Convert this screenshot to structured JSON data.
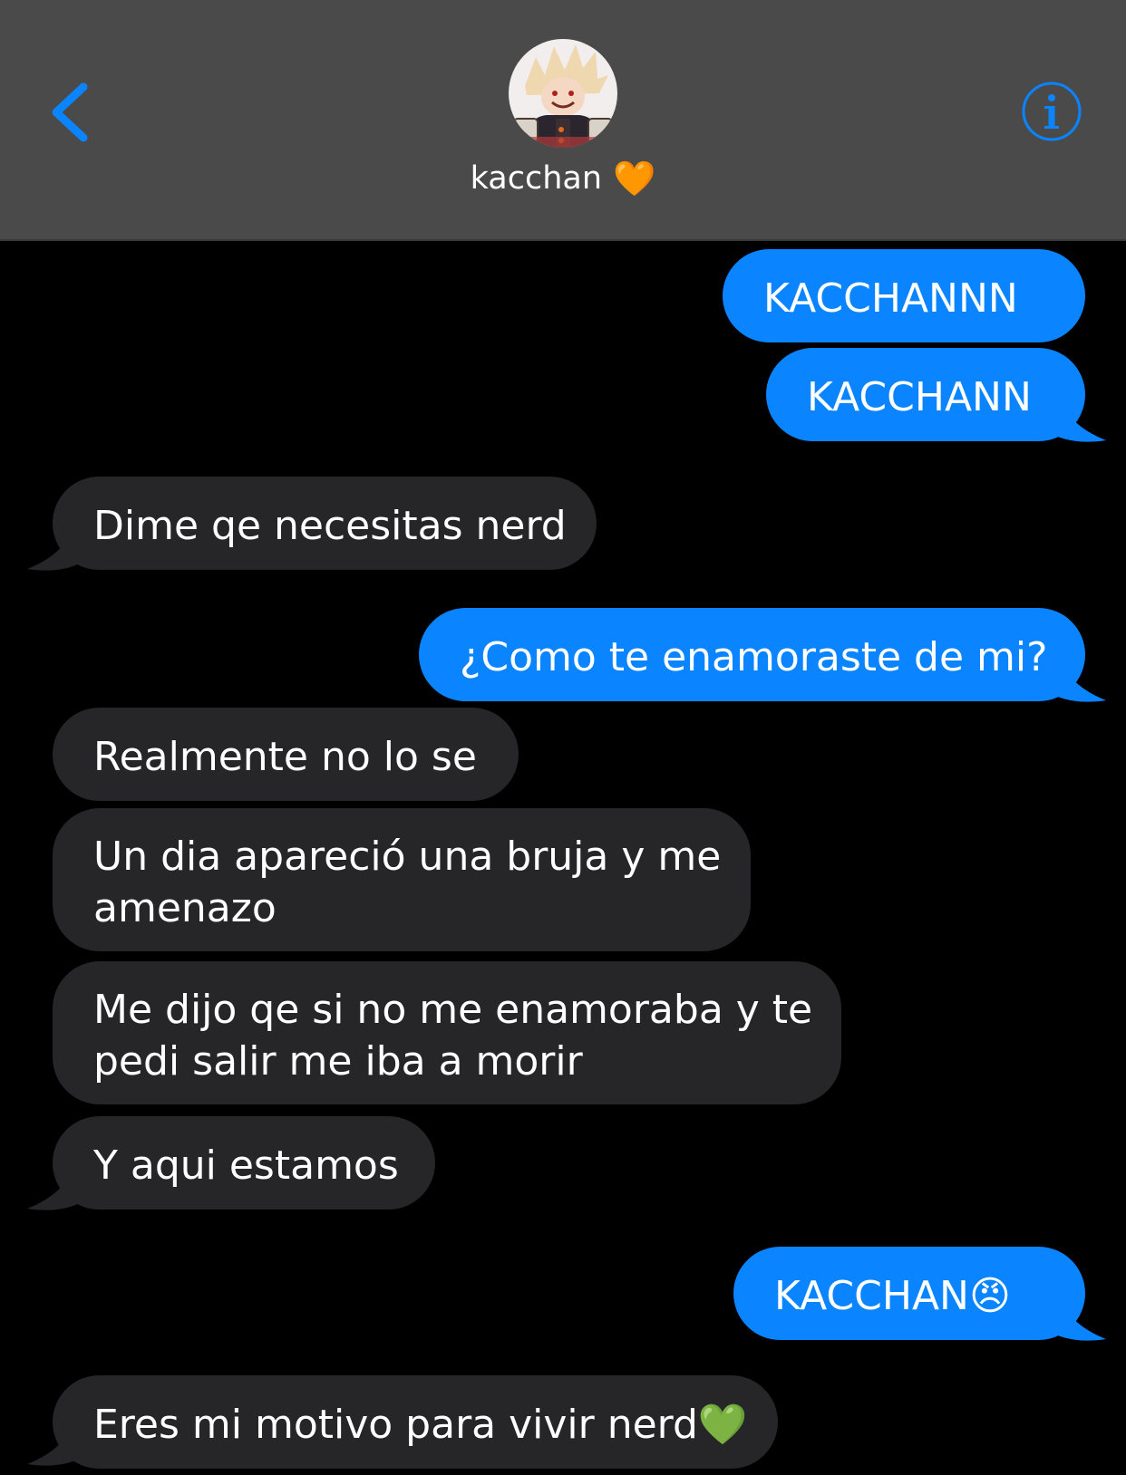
{
  "header": {
    "contact_name": "kacchan",
    "contact_emoji": "🧡",
    "back_icon": "chevron-left-icon",
    "info_icon": "info-circle-icon",
    "accent_color": "#0a84ff",
    "background_color": "#4a4a4b"
  },
  "colors": {
    "sent_bubble": "#0a84ff",
    "received_bubble": "#262629",
    "thread_background": "#000000"
  },
  "messages": [
    {
      "direction": "sent",
      "text": "KACCHANNN"
    },
    {
      "direction": "sent",
      "text": "KACCHANN"
    },
    {
      "direction": "received",
      "text": "Dime qe necesitas nerd"
    },
    {
      "direction": "sent",
      "text": "¿Como te enamoraste de mi?"
    },
    {
      "direction": "received",
      "text": "Realmente no lo se"
    },
    {
      "direction": "received",
      "line1": "Un dia apareció una bruja y me",
      "line2": "amenazo"
    },
    {
      "direction": "received",
      "line1": "Me dijo qe si no me enamoraba y te",
      "line2": "pedi salir me iba a morir"
    },
    {
      "direction": "received",
      "text": "Y aqui estamos"
    },
    {
      "direction": "sent",
      "text": "KACCHAN",
      "emoji": "😠"
    },
    {
      "direction": "received",
      "text": "Eres mi motivo para vivir nerd",
      "emoji": "💚"
    }
  ]
}
